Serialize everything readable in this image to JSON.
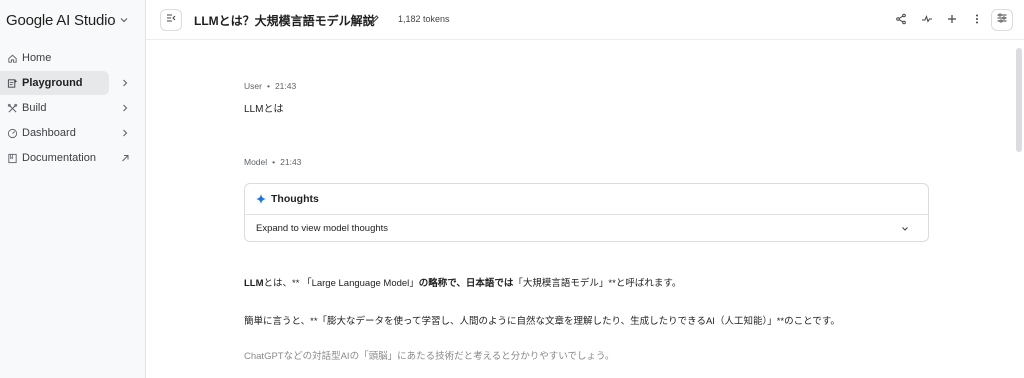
{
  "sidebar": {
    "brand": "Google AI Studio",
    "items": [
      {
        "label": "Home",
        "icon": "home-icon"
      },
      {
        "label": "Playground",
        "icon": "playground-icon",
        "active": true
      },
      {
        "label": "Build",
        "icon": "build-icon"
      },
      {
        "label": "Dashboard",
        "icon": "dashboard-icon"
      },
      {
        "label": "Documentation",
        "icon": "documentation-icon"
      }
    ]
  },
  "header": {
    "title": "LLMとは？大規模言語モデル解説",
    "tokens": "1,182 tokens"
  },
  "chat": {
    "user": {
      "role": "User",
      "time": "21:43",
      "text": "LLMとは"
    },
    "model": {
      "role": "Model",
      "time": "21:43",
      "thoughts_title": "Thoughts",
      "thoughts_expand": "Expand to view model thoughts",
      "p1_a": "LLM",
      "p1_b": "とは、** 「Large Language Model」",
      "p1_c": "の略称で、日本語では",
      "p1_d": "「大規模言語モデル」**と呼ばれます。",
      "p2": "簡単に言うと、**「膨大なデータを使って学習し、人間のように自然な文章を理解したり、生成したりできるAI（人工知能）」**のことです。",
      "p3": "ChatGPTなどの対話型AIの「頭脳」にあたる技術だと考えると分かりやすいでしょう。"
    }
  },
  "colors": {
    "accent": "#1a73e8",
    "sidebar_bg": "#f8f9fa",
    "active_bg": "#e6e8ea"
  }
}
